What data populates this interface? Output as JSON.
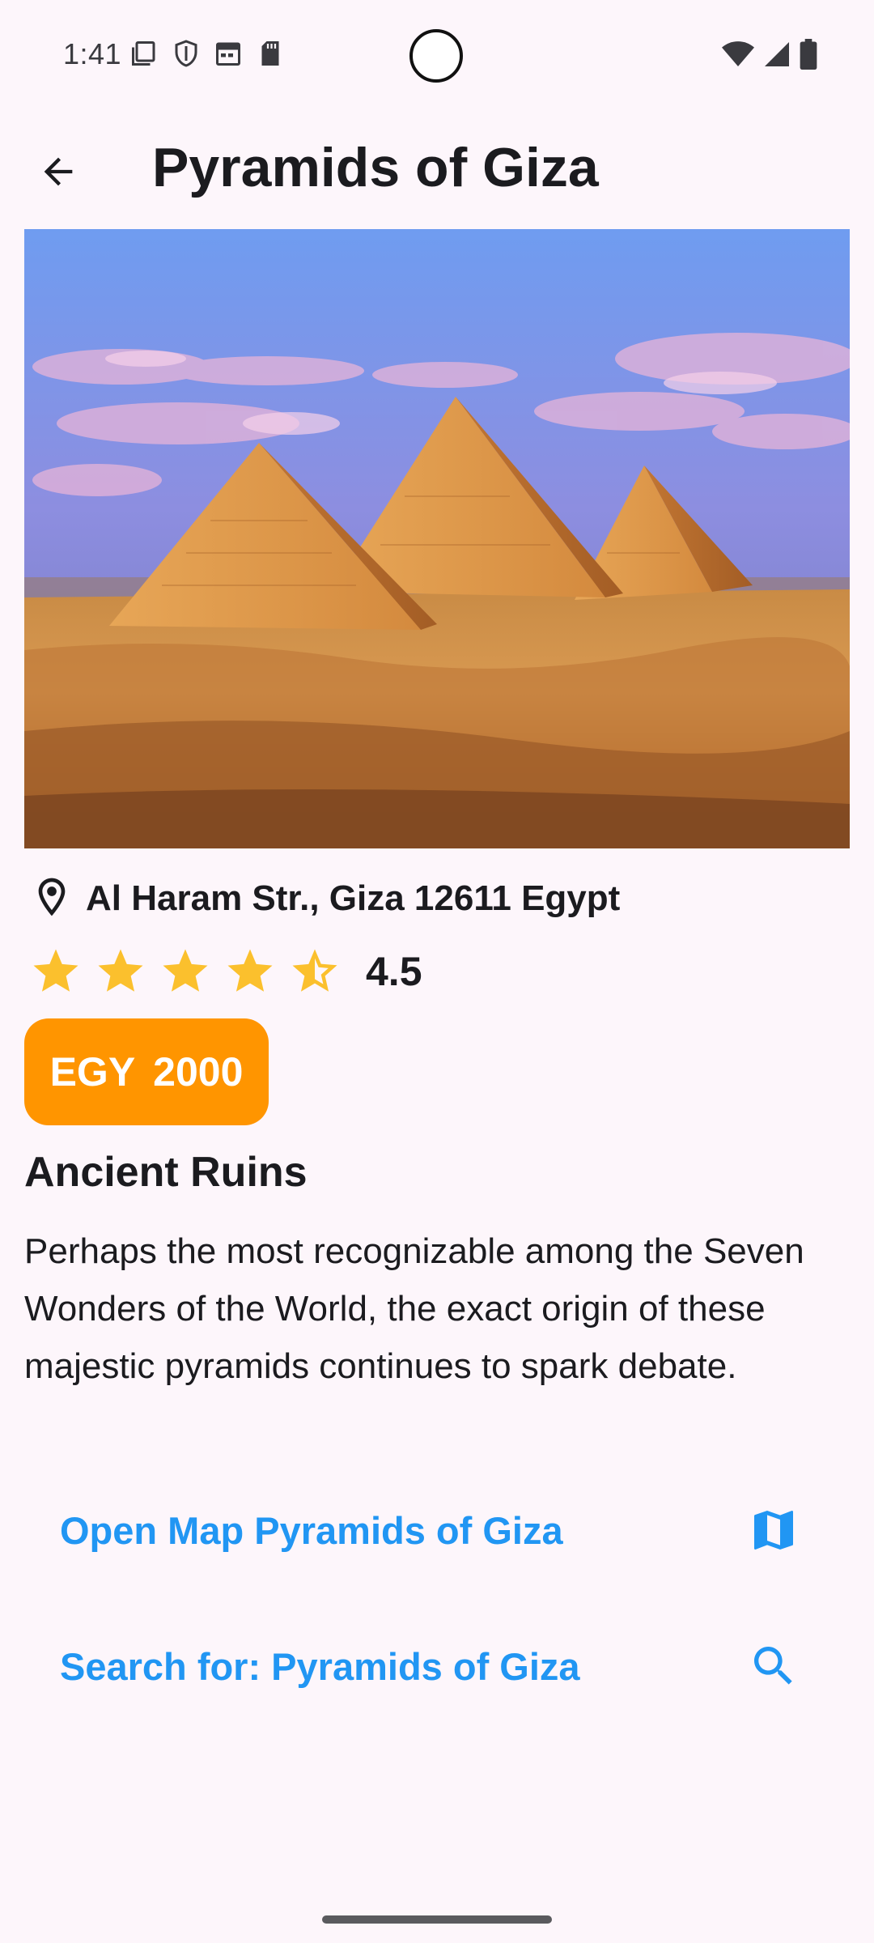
{
  "status_bar": {
    "time": "1:41",
    "left_icons": [
      "screen-icon",
      "shield-icon",
      "calendar-icon",
      "sd-card-icon"
    ],
    "right_icons": [
      "wifi-icon",
      "signal-icon",
      "battery-icon"
    ]
  },
  "app_bar": {
    "back_icon": "arrow-back-icon",
    "title": "Pyramids of Giza"
  },
  "hero_image": {
    "subject": "Pyramids of Giza photo"
  },
  "location": {
    "icon": "location-pin-icon",
    "address": "Al Haram Str., Giza 12611 Egypt"
  },
  "rating": {
    "value_text": "4.5",
    "value": 4.5,
    "max": 5,
    "color": "#fbc02d"
  },
  "price": {
    "currency": "EGY",
    "amount": "2000",
    "color": "#ff9500"
  },
  "category": "Ancient Ruins",
  "description": "Perhaps the most recognizable among the Seven Wonders of the World, the exact origin of these majestic pyramids continues to spark debate.",
  "actions": {
    "open_map": {
      "label": "Open Map Pyramids of Giza",
      "icon": "map-icon"
    },
    "search": {
      "label": "Search for: Pyramids of Giza",
      "icon": "search-icon"
    },
    "accent_color": "#2196f3"
  }
}
